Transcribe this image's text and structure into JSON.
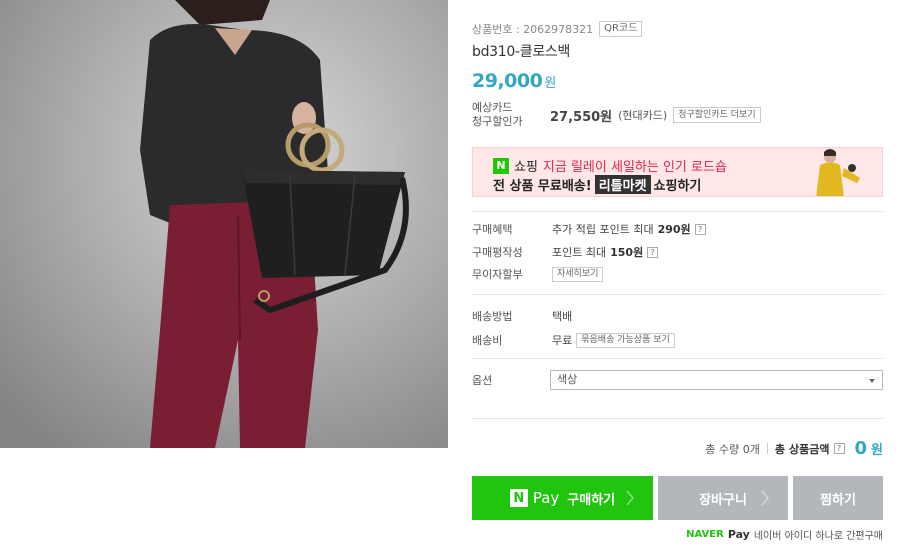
{
  "product": {
    "number_label": "상품번호 : 2062978321",
    "qr_label": "QR코드",
    "name": "bd310-클로스백",
    "price": "29,000",
    "price_unit": "원"
  },
  "card_discount": {
    "label_line1": "예상카드",
    "label_line2": "청구할인가",
    "price": "27,550원",
    "card_name": "(현대카드)",
    "more_label": "청구할인카드 더보기"
  },
  "banner": {
    "badge": "N",
    "prefix": "쇼핑",
    "highlight": "지금 릴레이 세일하는 인기 로드숍",
    "line2_pre": "전 상품 무료배송!",
    "line2_tag": "리틀마켓",
    "line2_post": "쇼핑하기"
  },
  "benefits": {
    "purchase_label": "구매혜택",
    "purchase_value": "추가 적립 포인트 최대",
    "purchase_amount": "290원",
    "review_label": "구매평작성",
    "review_value": "포인트 최대",
    "review_amount": "150원",
    "installment_label": "무이자할부",
    "installment_button": "자세히보기"
  },
  "shipping": {
    "method_label": "배송방법",
    "method_value": "택배",
    "fee_label": "배송비",
    "fee_value": "무료",
    "bundle_button": "묶음배송 가능상품 보기"
  },
  "option": {
    "label": "옵션",
    "selected": "색상"
  },
  "total": {
    "quantity_text": "총 수량 0개",
    "label_prefix": "총",
    "label": "상품금액",
    "amount": "0",
    "unit": "원",
    "help": "?"
  },
  "buttons": {
    "npay_logo": "N",
    "npay_text": "Pay",
    "buy": "구매하기",
    "cart": "장바구니",
    "wish": "찜하기"
  },
  "footer": {
    "naver": "NAVER",
    "pay": "Pay",
    "note": "네이버 아이디 하나로 간편구매"
  },
  "icons": {
    "help": "?"
  },
  "colors": {
    "accent": "#33a6c2",
    "npay_green": "#21c40f",
    "banner_bg": "#ffe7e7",
    "banner_highlight": "#e0244a",
    "secondary_button": "#b3b7bb",
    "pants": "#7a1f33",
    "top": "#2b2b2b"
  }
}
